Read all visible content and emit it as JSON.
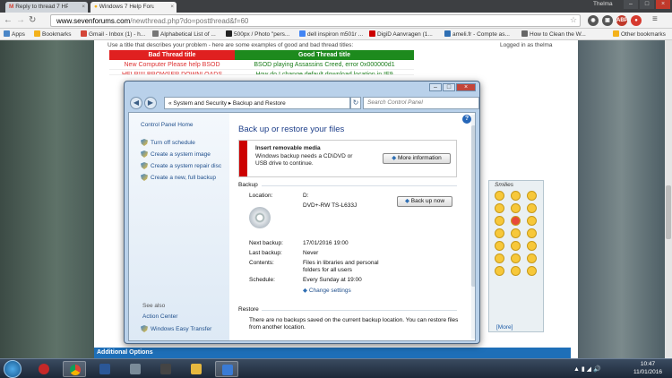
{
  "browser": {
    "tabs": [
      {
        "label": "Reply to thread 7 HP x64"
      },
      {
        "label": "Windows 7 Help Forums"
      }
    ],
    "profile": "Thelma",
    "url_host": "www.sevenforums.com",
    "url_path": "/newthread.php?do=postthread&f=60",
    "bookmarks": [
      {
        "label": "Apps",
        "color": "#4a86c7"
      },
      {
        "label": "Bookmarks",
        "color": "#f3b11b"
      },
      {
        "label": "Gmail - Inbox (1) - h...",
        "color": "#d44638"
      },
      {
        "label": "Alphabetical List of ...",
        "color": "#777"
      },
      {
        "label": "500px / Photo \"pers...",
        "color": "#222"
      },
      {
        "label": "dell inspiron m501r ...",
        "color": "#4285f4"
      },
      {
        "label": "Aanvragen (1...",
        "color": "#f3b11b"
      },
      {
        "label": "DigiD",
        "color": "#c00"
      },
      {
        "label": "ameli.fr - Compte as...",
        "color": "#2f6fb3"
      },
      {
        "label": "How to Clean the W...",
        "color": "#666"
      },
      {
        "label": "Other bookmarks",
        "color": "#f3b11b"
      }
    ],
    "ext_icons": [
      {
        "name": "abp-icon",
        "text": "ABP",
        "color": "#c0392b"
      },
      {
        "name": "ext-red-icon",
        "text": "●",
        "color": "#d63a2f"
      },
      {
        "name": "menu-icon",
        "text": "≡",
        "color": "#555"
      }
    ]
  },
  "forum": {
    "hint": "Use a title that describes your problem - here are some examples of good and bad thread titles:",
    "logged_in": "Logged in as thelma",
    "bad_header": "Bad Thread title",
    "good_header": "Good Thread title",
    "bad_examples": [
      "New Computer Please help BSOD",
      "HELP!!!! BROWSER DOWNLOADS"
    ],
    "good_examples": [
      "BSOD playing Assassins Creed, error 0x000000d1",
      "How do I change default download location in IE9"
    ],
    "smilies_label": "Smilies",
    "smilies_more": "[More]",
    "additional_options": "Additional Options"
  },
  "dialog": {
    "breadcrumb": "« System and Security ▸ Backup and Restore",
    "search_placeholder": "Search Control Panel",
    "left_home": "Control Panel Home",
    "left_links": [
      "Turn off schedule",
      "Create a system image",
      "Create a system repair disc",
      "Create a new, full backup"
    ],
    "see_also": "See also",
    "see_also_links": [
      "Action Center",
      "Windows Easy Transfer"
    ],
    "title": "Back up or restore your files",
    "notice_title": "Insert removable media",
    "notice_text": "Windows backup needs a CD\\DVD or USB drive to continue.",
    "more_info": "More information",
    "backup_header": "Backup",
    "location_label": "Location:",
    "location_value": "D:",
    "drive_value": "DVD+-RW TS-L633J",
    "backup_now": "Back up now",
    "next_backup_label": "Next backup:",
    "next_backup_value": "17/01/2016 19:00",
    "last_backup_label": "Last backup:",
    "last_backup_value": "Never",
    "contents_label": "Contents:",
    "contents_value": "Files in libraries and personal folders for all users",
    "schedule_label": "Schedule:",
    "schedule_value": "Every Sunday at 19:00",
    "change_settings": "Change settings",
    "restore_header": "Restore",
    "restore_text": "There are no backups saved on the current backup location. You can restore files from another location."
  },
  "taskbar": {
    "time": "10:47",
    "date": "11/01/2016",
    "icons": [
      {
        "name": "ladybug-app-icon",
        "color": "#c62828"
      },
      {
        "name": "chrome-icon",
        "color": "#e3a81b"
      },
      {
        "name": "word-icon",
        "color": "#2b5797"
      },
      {
        "name": "desktop-app-icon",
        "color": "#7a8b99"
      },
      {
        "name": "media-app-icon",
        "color": "#444"
      },
      {
        "name": "explorer-icon",
        "color": "#e6b83f"
      },
      {
        "name": "control-panel-icon",
        "color": "#3a7bd5"
      }
    ]
  }
}
